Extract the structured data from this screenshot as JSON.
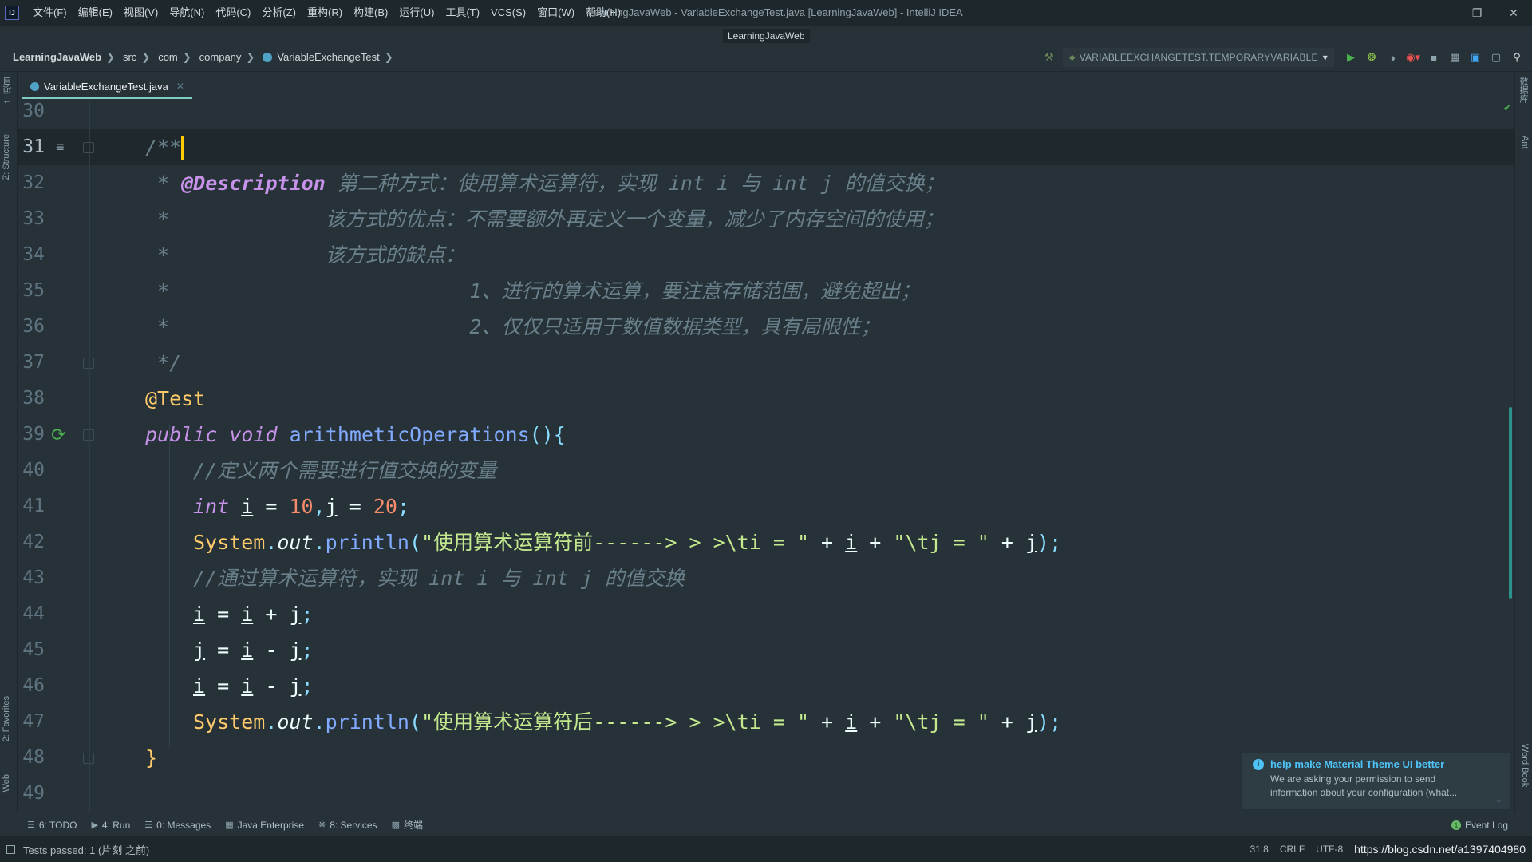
{
  "window": {
    "title": "LearningJavaWeb - VariableExchangeTest.java [LearningJavaWeb] - IntelliJ IDEA",
    "project_chip": "LearningJavaWeb",
    "menu": [
      "文件(F)",
      "编辑(E)",
      "视图(V)",
      "导航(N)",
      "代码(C)",
      "分析(Z)",
      "重构(R)",
      "构建(B)",
      "运行(U)",
      "工具(T)",
      "VCS(S)",
      "窗口(W)",
      "帮助(H)"
    ]
  },
  "breadcrumbs": [
    "LearningJavaWeb",
    "src",
    "com",
    "company",
    "VariableExchangeTest"
  ],
  "run_config": "VARIABLEEXCHANGETEST.TEMPORARYVARIABLE",
  "editor_tab": {
    "label": "VariableExchangeTest.java"
  },
  "left_strip": {
    "project": "1: 项目",
    "structure": "Z: Structure",
    "favorites": "2: Favorites",
    "web": "Web"
  },
  "right_strip": {
    "database": "数据库",
    "ant": "Ant",
    "wordbook": "Word Book"
  },
  "code_lines": [
    {
      "n": "30",
      "text": ""
    },
    {
      "n": "31",
      "text": "/**"
    },
    {
      "n": "32",
      "text": " * @Description 第二种方式：使用算术运算符，实现 int i 与 int j 的值交换；"
    },
    {
      "n": "33",
      "text": " *             该方式的优点：不需要额外再定义一个变量，减少了内存空间的使用；"
    },
    {
      "n": "34",
      "text": " *             该方式的缺点："
    },
    {
      "n": "35",
      "text": " *                         1、进行的算术运算，要注意存储范围，避免超出；"
    },
    {
      "n": "36",
      "text": " *                         2、仅仅只适用于数值数据类型，具有局限性；"
    },
    {
      "n": "37",
      "text": " */"
    },
    {
      "n": "38",
      "text": "@Test"
    },
    {
      "n": "39",
      "text": "public void arithmeticOperations(){"
    },
    {
      "n": "40",
      "text": "//定义两个需要进行值交换的变量"
    },
    {
      "n": "41",
      "text": "int i = 10,j = 20;"
    },
    {
      "n": "42",
      "text": "System.out.println(\"使用算术运算符前------> > >\\ti = \" + i + \"\\tj = \" + j);"
    },
    {
      "n": "43",
      "text": "//通过算术运算符，实现 int i 与 int j 的值交换"
    },
    {
      "n": "44",
      "text": "i = i + j;"
    },
    {
      "n": "45",
      "text": "j = i - j;"
    },
    {
      "n": "46",
      "text": "i = i - j;"
    },
    {
      "n": "47",
      "text": "System.out.println(\"使用算术运算符后------> > >\\ti = \" + i + \"\\tj = \" + j);"
    },
    {
      "n": "48",
      "text": "}"
    },
    {
      "n": "49",
      "text": ""
    }
  ],
  "notification": {
    "title": "help make Material Theme UI better",
    "body1": "We are asking your permission to send",
    "body2": "information about your configuration (what..."
  },
  "bottom_tools": [
    "6: TODO",
    "4: Run",
    "0: Messages",
    "Java Enterprise",
    "8: Services",
    "终端"
  ],
  "event_log": "Event Log",
  "status": {
    "message": "Tests passed: 1 (片刻 之前)",
    "position": "31:8",
    "line_sep": "CRLF",
    "encoding": "UTF-8",
    "url": "https://blog.csdn.net/a1397404980"
  }
}
